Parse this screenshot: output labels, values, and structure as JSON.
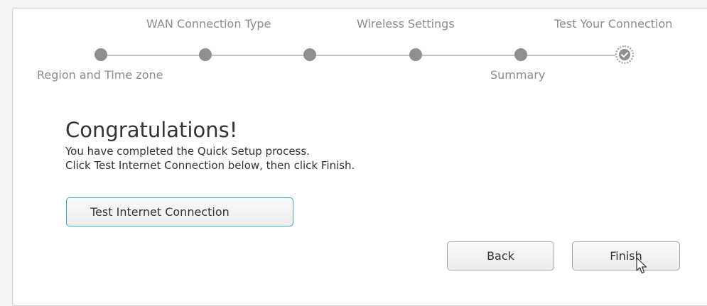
{
  "steps": {
    "top_labels": [
      "WAN Connection Type",
      "Wireless Settings",
      "Test Your Connection"
    ],
    "bottom_labels": [
      "Region and Time zone",
      "Summary"
    ],
    "current_step_icon": "check-icon"
  },
  "main": {
    "heading": "Congratulations!",
    "line1": "You have completed the Quick Setup process.",
    "line2": "Click Test Internet Connection below, then click Finish.",
    "test_button_label": "Test Internet Connection"
  },
  "footer": {
    "back_label": "Back",
    "finish_label": "Finish"
  },
  "colors": {
    "accent_border": "#3ba4d8",
    "step_dot": "#8f8f8f",
    "text_muted": "#8c8c8c"
  }
}
